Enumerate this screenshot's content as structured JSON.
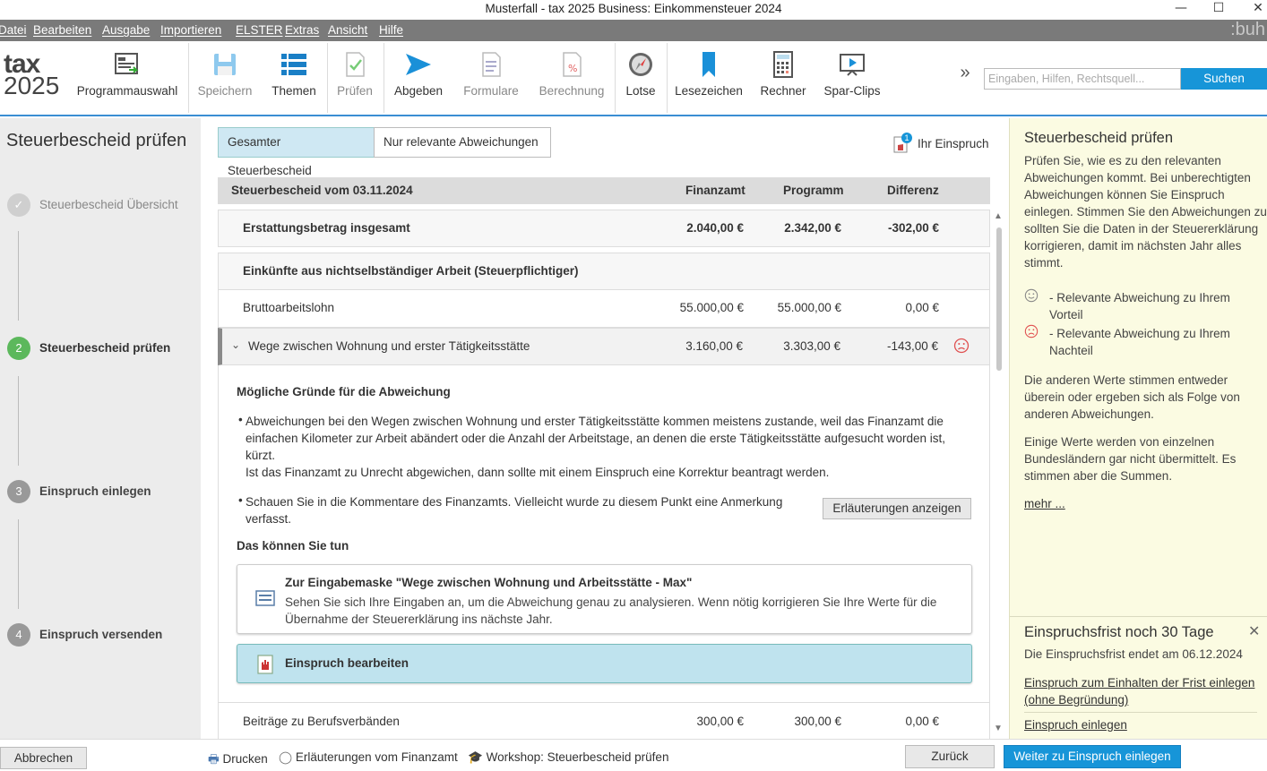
{
  "window": {
    "title": "Musterfall - tax 2025 Business: Einkommensteuer 2024"
  },
  "menu": [
    "Datei",
    "Bearbeiten",
    "Ausgabe",
    "Importieren",
    "ELSTER",
    "Extras",
    "Ansicht",
    "Hilfe"
  ],
  "brand": ":buh",
  "logo": {
    "line1": "tax",
    "line2": "2025"
  },
  "toolbar": {
    "programmauswahl": "Programmauswahl",
    "speichern": "Speichern",
    "themen": "Themen",
    "pruefen": "Prüfen",
    "abgeben": "Abgeben",
    "formulare": "Formulare",
    "berechnung": "Berechnung",
    "lotse": "Lotse",
    "lesezeichen": "Lesezeichen",
    "rechner": "Rechner",
    "sparclips": "Spar-Clips",
    "more": "»"
  },
  "search": {
    "placeholder": "Eingaben, Hilfen, Rechtsquell...",
    "button": "Suchen"
  },
  "left": {
    "heading": "Steuerbescheid prüfen",
    "steps": [
      {
        "num": "✓",
        "label": "Steuerbescheid Übersicht"
      },
      {
        "num": "2",
        "label": "Steuerbescheid prüfen"
      },
      {
        "num": "3",
        "label": "Einspruch einlegen"
      },
      {
        "num": "4",
        "label": "Einspruch versenden"
      }
    ]
  },
  "main": {
    "seg_all": "Gesamter Steuerbescheid",
    "seg_rel": "Nur relevante Abweichungen",
    "einspruch_badge": "1",
    "einspruch_label": "Ihr Einspruch",
    "table_header": {
      "title": "Steuerbescheid vom 03.11.2024",
      "col1": "Finanzamt",
      "col2": "Programm",
      "col3": "Differenz"
    },
    "rows": {
      "erstattung": {
        "label": "Erstattungsbetrag insgesamt",
        "fa": "2.040,00 €",
        "prog": "2.342,00 €",
        "diff": "-302,00 €"
      },
      "einkuenfte": {
        "label": "Einkünfte aus nichtselbständiger Arbeit (Steuerpflichtiger)"
      },
      "brutto": {
        "label": "Bruttoarbeitslohn",
        "fa": "55.000,00 €",
        "prog": "55.000,00 €",
        "diff": "0,00 €"
      },
      "wege": {
        "label": "Wege zwischen Wohnung und erster Tätigkeitsstätte",
        "fa": "3.160,00 €",
        "prog": "3.303,00 €",
        "diff": "-143,00 €"
      },
      "beitraege": {
        "label": "Beiträge zu Berufsverbänden",
        "fa": "300,00 €",
        "prog": "300,00 €",
        "diff": "0,00 €"
      }
    },
    "detail": {
      "gruende_title": "Mögliche Gründe für die Abweichung",
      "bullet1_l1": "Abweichungen bei den Wegen zwischen Wohnung und erster Tätigkeitsstätte kommen meistens zustande, weil das Finanzamt die",
      "bullet1_l2": "einfachen Kilometer zur Arbeit abändert oder die Anzahl der Arbeitstage, an denen die erste Tätigkeitsstätte aufgesucht worden ist,",
      "bullet1_l3": "kürzt.",
      "bullet1_l4": "Ist das Finanzamt zu Unrecht abgewichen, dann sollte mit einem Einspruch eine Korrektur beantragt werden.",
      "bullet2_l1": "Schauen Sie in die Kommentare des Finanzamts. Vielleicht wurde zu diesem Punkt eine Anmerkung",
      "bullet2_l2": "verfasst.",
      "erlaeuterungen_btn": "Erläuterungen anzeigen",
      "tun_title": "Das können Sie tun",
      "card1_title": "Zur Eingabemaske \"Wege zwischen Wohnung und Arbeitsstätte - Max\"",
      "card1_l1": "Sehen Sie sich Ihre Eingaben an, um die Abweichung genau zu analysieren. Wenn nötig korrigieren Sie Ihre Werte für die",
      "card1_l2": "Übernahme der Steuererklärung ins nächste Jahr.",
      "card2_title": "Einspruch bearbeiten"
    }
  },
  "right": {
    "heading": "Steuerbescheid prüfen",
    "intro": [
      "Prüfen Sie, wie es zu den relevanten",
      "Abweichungen kommt. Bei unberechtigten",
      "Abweichungen können Sie Einspruch",
      "einlegen. Stimmen Sie den Abweichungen zu",
      "sollten Sie die Daten in der Steuererklärung",
      "korrigieren, damit im nächsten Jahr alles",
      "stimmt."
    ],
    "legend_pos": [
      "- Relevante Abweichung zu Ihrem",
      "Vorteil"
    ],
    "legend_neg": [
      "- Relevante Abweichung zu Ihrem",
      "Nachteil"
    ],
    "other": [
      "Die anderen Werte stimmen entweder",
      "überein oder ergeben sich als Folge von",
      "anderen Abweichungen."
    ],
    "laender": [
      "Einige Werte werden von einzelnen",
      "Bundesländern gar nicht übermittelt. Es",
      "stimmen aber die Summen."
    ],
    "mehr": "mehr ...",
    "frist_title": "Einspruchsfrist noch 30 Tage",
    "frist_text": "Die Einspruchsfrist endet am 06.12.2024",
    "frist_link1": [
      "Einspruch zum Einhalten der Frist einlegen",
      "(ohne Begründung)"
    ],
    "frist_link2": "Einspruch einlegen"
  },
  "footer": {
    "abbrechen": "Abbrechen",
    "drucken": "Drucken",
    "erlaeuterungen": "Erläuterungen vom Finanzamt",
    "workshop": "Workshop: Steuerbescheid prüfen",
    "zurueck": "Zurück",
    "weiter": "Weiter zu Einspruch einlegen"
  },
  "colors": {
    "accent": "#1795d8",
    "step_active": "#5cb85c",
    "sad": "#e05050"
  }
}
